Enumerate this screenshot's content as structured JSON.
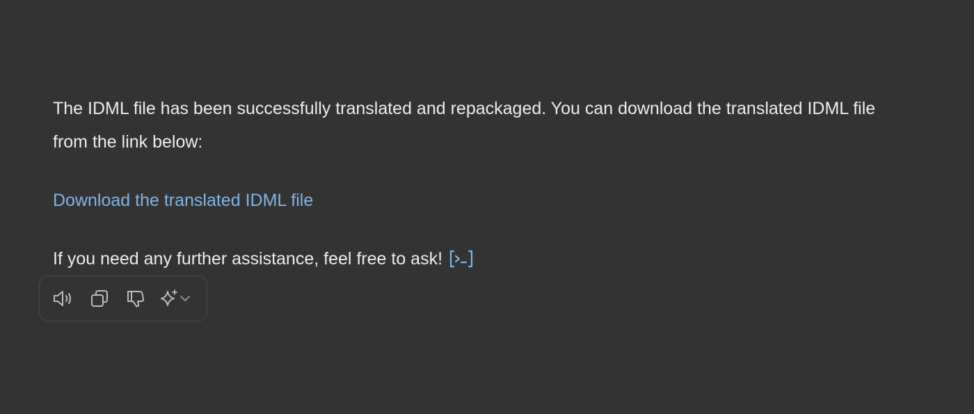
{
  "message": {
    "paragraph": "The IDML file has been successfully translated and repackaged. You can download the translated IDML file from the link below:",
    "link_text": "Download the translated IDML file",
    "closing": "If you need any further assistance, feel free to ask!"
  },
  "icons": {
    "code_interpreter": "code-interpreter-icon",
    "read_aloud": "speaker-icon",
    "copy": "copy-icon",
    "dislike": "thumbs-down-icon",
    "regenerate": "sparkle-icon",
    "dropdown": "chevron-down-icon"
  },
  "colors": {
    "background": "#333333",
    "text": "#ececec",
    "link": "#7fb4e6",
    "icon": "#bcbcbc",
    "toolbar_border": "#4a4a4a"
  }
}
